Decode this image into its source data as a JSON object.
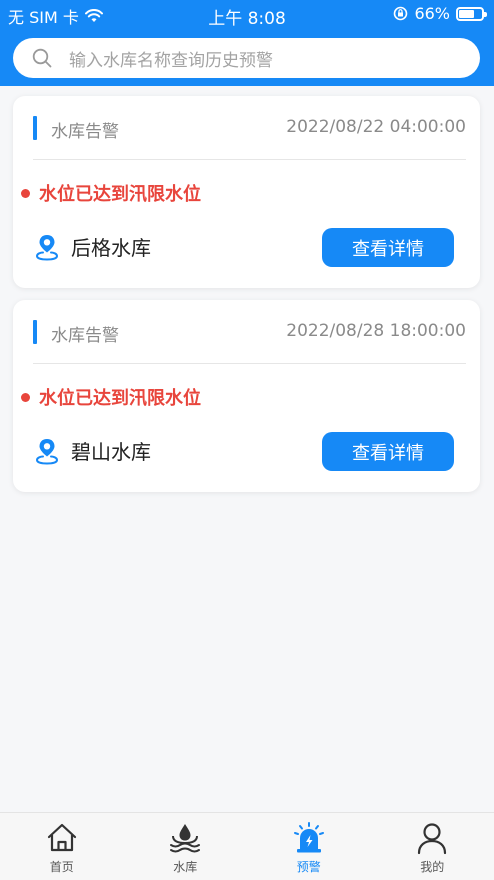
{
  "status_bar": {
    "carrier": "无 SIM 卡",
    "time": "上午 8:08",
    "battery": "66%",
    "battery_level": 0.66
  },
  "search": {
    "placeholder": "输入水库名称查询历史预警"
  },
  "alerts": [
    {
      "type": "水库告警",
      "time": "2022/08/22 04:00:00",
      "message": "水位已达到汛限水位",
      "reservoir": "后格水库",
      "button": "查看详情"
    },
    {
      "type": "水库告警",
      "time": "2022/08/28 18:00:00",
      "message": "水位已达到汛限水位",
      "reservoir": "碧山水库",
      "button": "查看详情"
    }
  ],
  "tabs": [
    {
      "label": "首页",
      "icon": "home-icon",
      "active": false
    },
    {
      "label": "水库",
      "icon": "reservoir-icon",
      "active": false
    },
    {
      "label": "预警",
      "icon": "alarm-icon",
      "active": true
    },
    {
      "label": "我的",
      "icon": "user-icon",
      "active": false
    }
  ],
  "colors": {
    "primary": "#1689f6",
    "alert": "#e8453c",
    "inactive_icon": "#333333"
  }
}
